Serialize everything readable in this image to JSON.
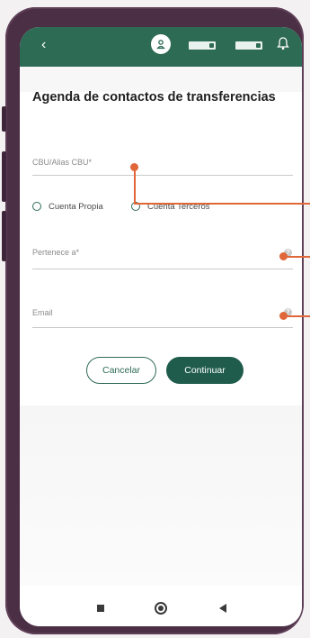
{
  "header": {
    "back_icon": "chevron-left-icon",
    "avatar_icon": "user-icon",
    "notification_icon": "bell-icon"
  },
  "page": {
    "title": "Agenda de contactos de transferencias"
  },
  "form": {
    "cbu": {
      "label": "CBU/Alias CBU*",
      "value": ""
    },
    "account_type": {
      "options": [
        "Cuenta Propia",
        "Cuenta Terceros"
      ],
      "selected": null
    },
    "pertenece": {
      "label": "Pertenece a*",
      "value": ""
    },
    "email": {
      "label": "Email",
      "value": ""
    }
  },
  "actions": {
    "cancel_label": "Cancelar",
    "continue_label": "Continuar"
  },
  "colors": {
    "brand": "#2e6b55",
    "button_dark": "#1f5c4b",
    "callout": "#e0673a",
    "phone_frame": "#4b2f45"
  },
  "system_nav": {
    "recent_icon": "square-icon",
    "home_icon": "circle-icon",
    "back_icon": "triangle-back-icon"
  }
}
